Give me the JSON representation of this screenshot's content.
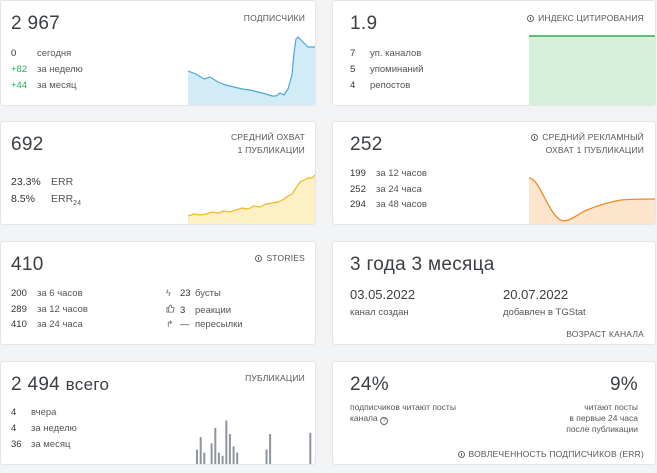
{
  "subscribers": {
    "value": "2 967",
    "caption": "ПОДПИСЧИКИ",
    "rows": [
      {
        "num": "0",
        "label": "сегодня"
      },
      {
        "num": "+82",
        "label": "за неделю"
      },
      {
        "num": "+44",
        "label": "за месяц"
      }
    ],
    "color": "#49a9d6"
  },
  "citation": {
    "value": "1.9",
    "caption": "ИНДЕКС ЦИТИРОВАНИЯ",
    "rows": [
      {
        "num": "7",
        "label": "уп. каналов"
      },
      {
        "num": "5",
        "label": "упоминаний"
      },
      {
        "num": "4",
        "label": "репостов"
      }
    ],
    "color": "#2eaf4a"
  },
  "reach": {
    "value": "692",
    "caption1": "СРЕДНИЙ ОХВАТ",
    "caption2": "1 ПУБЛИКАЦИИ",
    "rows": [
      {
        "num": "23.3%",
        "label": "ERR"
      },
      {
        "num": "8.5%",
        "label": "ERR",
        "sub": "24"
      }
    ],
    "color": "#f2b91e"
  },
  "ad_reach": {
    "value": "252",
    "caption1": "СРЕДНИЙ РЕКЛАМНЫЙ",
    "caption2": "ОХВАТ 1 ПУБЛИКАЦИИ",
    "rows": [
      {
        "num": "199",
        "label": "за 12 часов"
      },
      {
        "num": "252",
        "label": "за 24 часа"
      },
      {
        "num": "294",
        "label": "за 48 часов"
      }
    ],
    "color": "#ee8a24"
  },
  "stories": {
    "value": "410",
    "caption": "STORIES",
    "rows": [
      {
        "num": "200",
        "label": "за 6 часов"
      },
      {
        "num": "289",
        "label": "за 12 часов"
      },
      {
        "num": "410",
        "label": "за 24 часа"
      }
    ],
    "rows2": [
      {
        "icon": "bolt-icon",
        "glyph": "ϟ",
        "num": "23",
        "label": "бусты"
      },
      {
        "icon": "thumbs-up-icon",
        "glyph": "👍",
        "num": "3",
        "label": "реакции"
      },
      {
        "icon": "forward-icon",
        "glyph": "↱",
        "num": "—",
        "label": "пересылки"
      }
    ]
  },
  "age": {
    "value": "3 года 3 месяца",
    "created_date": "03.05.2022",
    "created_label": "канал создан",
    "added_date": "20.07.2022",
    "added_label": "добавлен в TGStat",
    "caption": "ВОЗРАСТ КАНАЛА"
  },
  "posts": {
    "value": "2 494",
    "suffix": "всего",
    "caption": "ПУБЛИКАЦИИ",
    "rows": [
      {
        "num": "4",
        "label": "вчера"
      },
      {
        "num": "4",
        "label": "за неделю"
      },
      {
        "num": "36",
        "label": "за месяц"
      }
    ],
    "bar_heights": [
      0.25,
      0.45,
      0.2,
      0.0,
      0.35,
      0.6,
      0.2,
      0.15,
      0.72,
      0.5,
      0.3,
      0.2,
      0.0,
      0.0,
      0.0,
      0.0,
      0.0,
      0.0,
      0.0,
      0.25,
      0.5,
      0.0,
      0.0,
      0.0,
      0.0,
      0.0,
      0.0,
      0.0,
      0.0,
      0.0,
      0.0,
      0.52
    ],
    "color": "#8e959c"
  },
  "engagement": {
    "pct1": "24%",
    "text1_line1": "подписчиков читают посты",
    "text1_line2": "канала",
    "pct2": "9%",
    "text2_line1": "читают посты",
    "text2_line2": "в первые 24 часа",
    "text2_line3": "после публикации",
    "caption": "ВОВЛЕЧЕННОСТЬ ПОДПИСЧИКОВ (ERR)"
  }
}
